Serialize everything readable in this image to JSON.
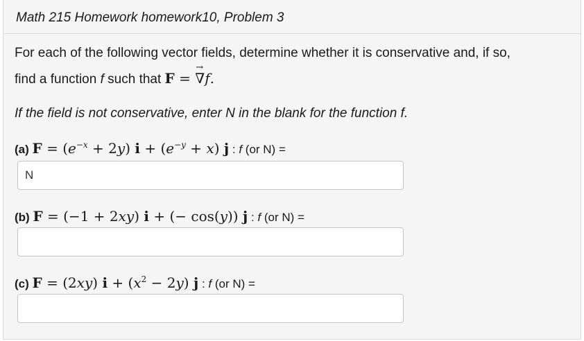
{
  "header": {
    "title": "Math 215 Homework homework10, Problem 3"
  },
  "intro": {
    "line1": "For each of the following vector fields, determine whether it is conservative and, if so,",
    "line2_prefix": "find a function",
    "line2_f": "f",
    "line2_mid": "such that",
    "hint_prefix": "If the field is not conservative, enter N in the blank for the function",
    "hint_f": "f",
    "hint_suffix": "."
  },
  "parts": [
    {
      "label": "(a)",
      "suffix_f": "f",
      "suffix_rest": "(or N) =",
      "answer": "N"
    },
    {
      "label": "(b)",
      "suffix_f": "f",
      "suffix_rest": "(or N) =",
      "answer": ""
    },
    {
      "label": "(c)",
      "suffix_f": "f",
      "suffix_rest": "(or N) =",
      "answer": ""
    }
  ]
}
